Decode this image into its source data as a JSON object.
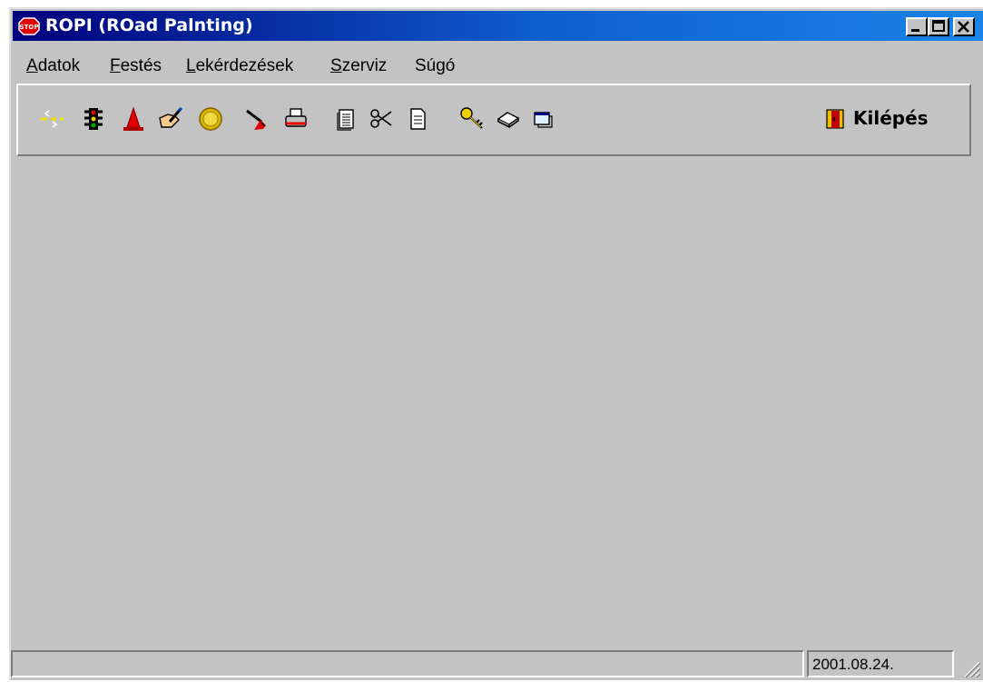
{
  "window": {
    "title": "ROPI (ROad Palnting)",
    "title_icon": "stop-sign-icon",
    "controls": [
      "minimize-icon",
      "maximize-icon",
      "close-icon"
    ]
  },
  "menu": {
    "items": [
      {
        "first": "A",
        "rest": "datok"
      },
      {
        "first": "F",
        "rest": "estés"
      },
      {
        "first": "L",
        "rest": "ekérdezések"
      },
      {
        "first": "S",
        "rest": "zerviz"
      },
      {
        "first": "",
        "rest": "Súgó"
      }
    ]
  },
  "toolbar": {
    "tools": [
      "road-marking-icon",
      "traffic-light-icon",
      "traffic-cone-icon",
      "hand-pencil-icon",
      "coin-icon",
      "paint-brush-icon",
      "printer-icon",
      "document-icon",
      "scissors-icon",
      "page-icon",
      "key-icon",
      "eraser-icon",
      "window-icon"
    ],
    "exit_label": "Kilépés",
    "exit_icon": "exit-door-icon"
  },
  "statusbar": {
    "left_text": "",
    "date": "2001.08.24."
  },
  "colors": {
    "face": "#c3c3c3",
    "title_start": "#00007b",
    "title_end": "#1a84e8"
  }
}
